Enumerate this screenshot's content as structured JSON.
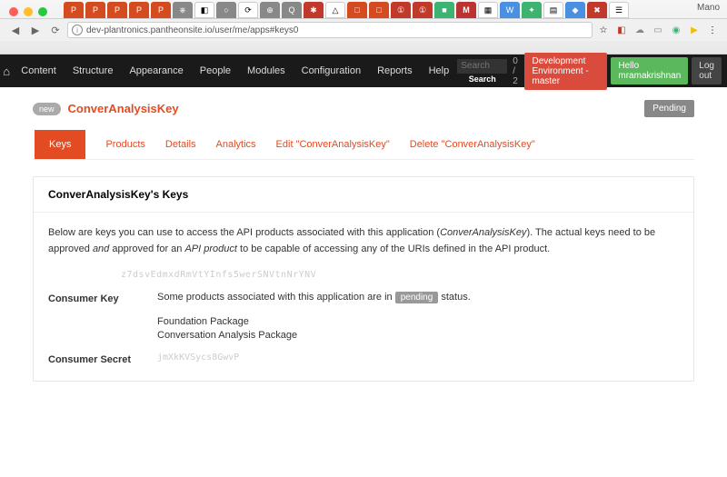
{
  "browser": {
    "profile": "Mano",
    "url": "dev-plantronics.pantheonsite.io/user/me/apps#keys0"
  },
  "admin": {
    "menu": [
      "Content",
      "Structure",
      "Appearance",
      "People",
      "Modules",
      "Configuration",
      "Reports",
      "Help"
    ],
    "search_placeholder": "Search",
    "search_label": "Search",
    "count": "0 / 2",
    "env": "Development Environment - master",
    "hello": "Hello mramakrishnan",
    "logout": "Log out"
  },
  "app": {
    "new_badge": "new",
    "title": "ConverAnalysisKey",
    "status": "Pending"
  },
  "tabs": {
    "keys": "Keys",
    "products": "Products",
    "details": "Details",
    "analytics": "Analytics",
    "edit": "Edit \"ConverAnalysisKey\"",
    "delete": "Delete \"ConverAnalysisKey\""
  },
  "card": {
    "heading": "ConverAnalysisKey's Keys",
    "intro_pre": "Below are keys you can use to access the API products associated with this application (",
    "intro_app": "ConverAnalysisKey",
    "intro_mid": "). The actual keys need to be approved ",
    "intro_and": "and",
    "intro_post": " approved for an ",
    "intro_api": "API product",
    "intro_tail": " to be capable of accessing any of the URIs defined in the API product.",
    "key_value": "z7dsvEdmxdRmVtYInfs5werSNVtnNrYNV",
    "consumer_key_label": "Consumer Key",
    "pending_sentence_pre": "Some products associated with this application are in ",
    "pending_chip": "pending",
    "pending_sentence_post": " status.",
    "pkg1": "Foundation Package",
    "pkg2": "Conversation Analysis Package",
    "consumer_secret_label": "Consumer Secret",
    "secret_value": "jmXkKVSycs8GwvP"
  }
}
